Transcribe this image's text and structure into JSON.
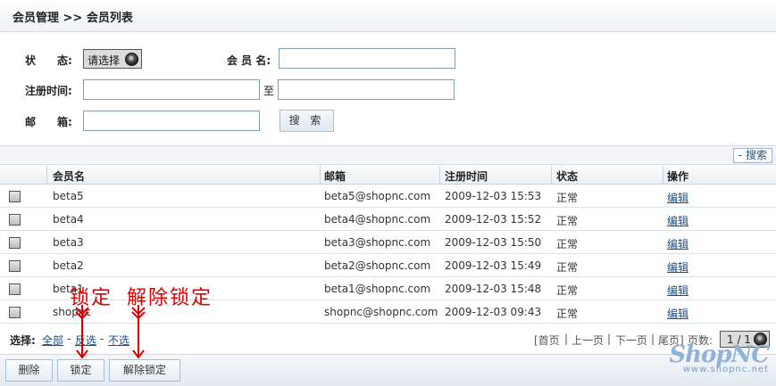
{
  "header": {
    "title": "会员管理 >> 会员列表"
  },
  "filters": {
    "status_label": "状　　态:",
    "status_select_value": "请选择",
    "member_label": "会 员 名:",
    "member_value": "",
    "regtime_label": "注册时间:",
    "regtime_to": "至",
    "email_label": "邮　　箱:",
    "email_value": "",
    "search_button": "搜 索"
  },
  "toggle_search": "- 搜索",
  "table": {
    "columns": [
      "会员名",
      "邮箱",
      "注册时间",
      "状态",
      "操作"
    ],
    "rows": [
      {
        "name": "beta5",
        "email": "beta5@shopnc.com",
        "time": "2009-12-03 15:53",
        "status": "正常",
        "action": "编辑"
      },
      {
        "name": "beta4",
        "email": "beta4@shopnc.com",
        "time": "2009-12-03 15:52",
        "status": "正常",
        "action": "编辑"
      },
      {
        "name": "beta3",
        "email": "beta3@shopnc.com",
        "time": "2009-12-03 15:50",
        "status": "正常",
        "action": "编辑"
      },
      {
        "name": "beta2",
        "email": "beta2@shopnc.com",
        "time": "2009-12-03 15:49",
        "status": "正常",
        "action": "编辑"
      },
      {
        "name": "beta1",
        "email": "beta1@shopnc.com",
        "time": "2009-12-03 15:48",
        "status": "正常",
        "action": "编辑"
      },
      {
        "name": "shopnc",
        "email": "shopnc@shopnc.com",
        "time": "2009-12-03 09:43",
        "status": "正常",
        "action": "编辑"
      }
    ]
  },
  "selection": {
    "label": "选择:",
    "all": "全部",
    "invert": "反选",
    "none": "不选"
  },
  "pager": {
    "first": "[首页",
    "prev": "上一页",
    "next": "下一页",
    "last": "尾页]",
    "pages_label": "页数:",
    "page_value": "1 / 1"
  },
  "actions": {
    "delete": "删除",
    "lock": "锁定",
    "unlock": "解除锁定"
  },
  "annotation": {
    "lock": "锁定",
    "unlock": "解除锁定",
    "color": "#e00000"
  },
  "logo": {
    "brand": "ShopNC",
    "url": "www.shopnc.net"
  }
}
